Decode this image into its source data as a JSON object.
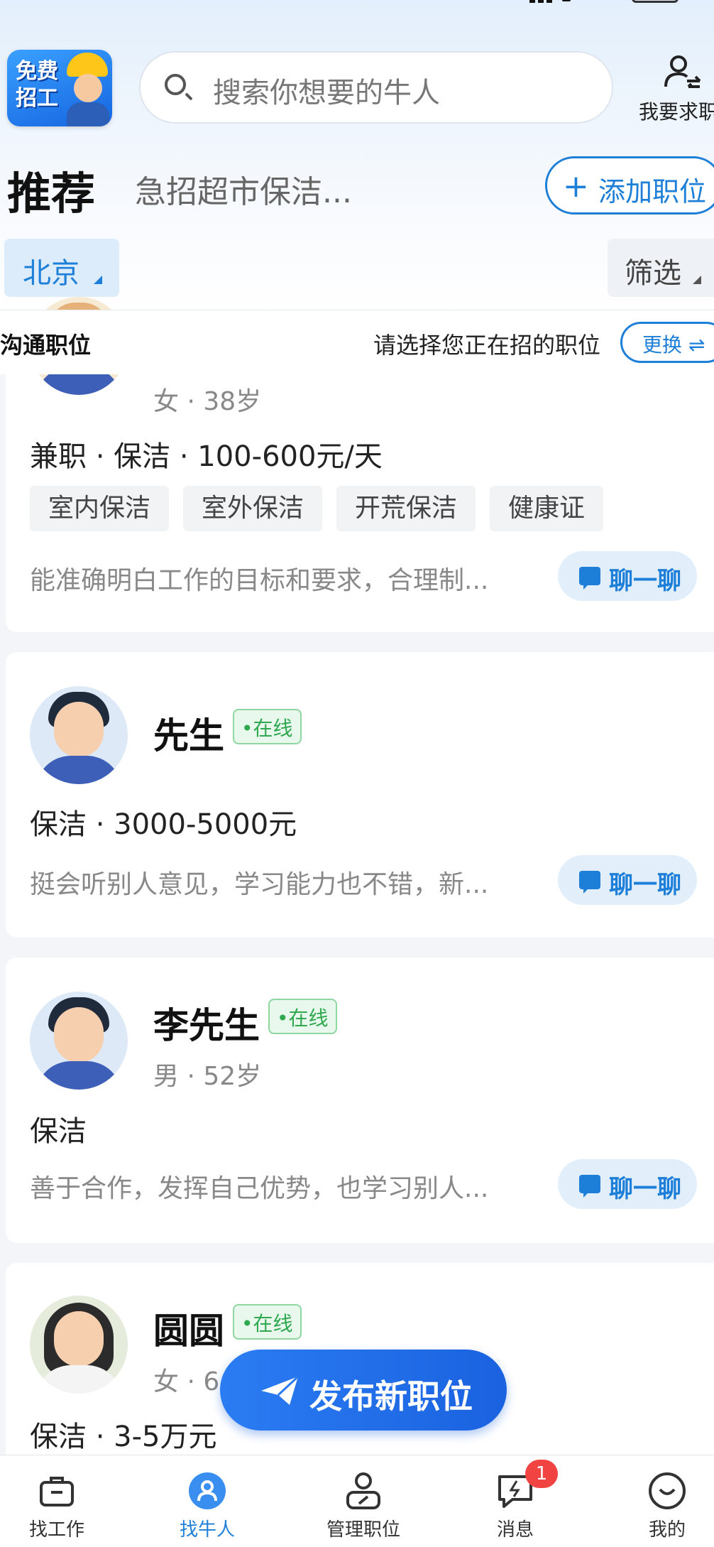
{
  "header": {
    "search_placeholder": "搜索你想要的牛人",
    "logo_text": "免费招工",
    "switch_label": "我要求职"
  },
  "recommend": {
    "title": "推荐",
    "subtitle": "急招超市保洁...",
    "add_position": "添加职位"
  },
  "filters": {
    "city": "北京",
    "filter": "筛选"
  },
  "position_bar": {
    "label": "沟通职位",
    "prompt": "请选择您正在招的职位",
    "swap": "更换 ⇌"
  },
  "candidates": [
    {
      "name": "",
      "meta": "女 · 38岁",
      "job": "兼职 · 保洁 · 100-600元/天",
      "tags": [
        "室内保洁",
        "室外保洁",
        "开荒保洁",
        "健康证"
      ],
      "desc": "能准确明白工作的目标和要求，合理制...",
      "chat": "聊一聊"
    },
    {
      "name": "先生",
      "online": "•在线",
      "job": "保洁 · 3000-5000元",
      "desc": "挺会听别人意见，学习能力也不错，新...",
      "chat": "聊一聊"
    },
    {
      "name": "李先生",
      "online": "•在线",
      "meta": "男 · 52岁",
      "job": "保洁",
      "desc": "善于合作，发挥自己优势，也学习别人...",
      "chat": "聊一聊"
    },
    {
      "name": "圆圆",
      "online": "•在线",
      "meta": "女 · 6",
      "job": "保洁 · 3-5万元"
    }
  ],
  "publish_button": "发布新职位",
  "tabs": [
    {
      "label": "找工作",
      "icon": "briefcase-icon"
    },
    {
      "label": "找牛人",
      "icon": "person-icon",
      "active": true
    },
    {
      "label": "管理职位",
      "icon": "manage-icon"
    },
    {
      "label": "消息",
      "icon": "message-icon",
      "badge": "1"
    },
    {
      "label": "我的",
      "icon": "smile-icon"
    }
  ],
  "colors": {
    "accent": "#1e7fd8",
    "online_green": "#2fa84f",
    "badge_red": "#f24343"
  }
}
